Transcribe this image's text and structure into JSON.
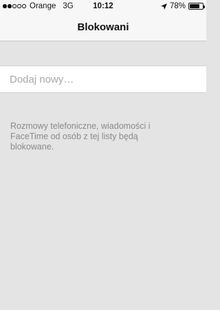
{
  "status_bar": {
    "signal_bars_total": 5,
    "signal_bars_filled": 2,
    "carrier": "Orange",
    "network": "3G",
    "time": "10:12",
    "location_icon": "location-arrow-icon",
    "battery_percent_label": "78%",
    "battery_level": 0.78
  },
  "nav": {
    "title": "Blokowani"
  },
  "add_field": {
    "placeholder": "Dodaj nowy…",
    "value": ""
  },
  "footer": {
    "text": "Rozmowy telefoniczne, wiadomości i FaceTime od osób z tej listy będą blokowane."
  }
}
